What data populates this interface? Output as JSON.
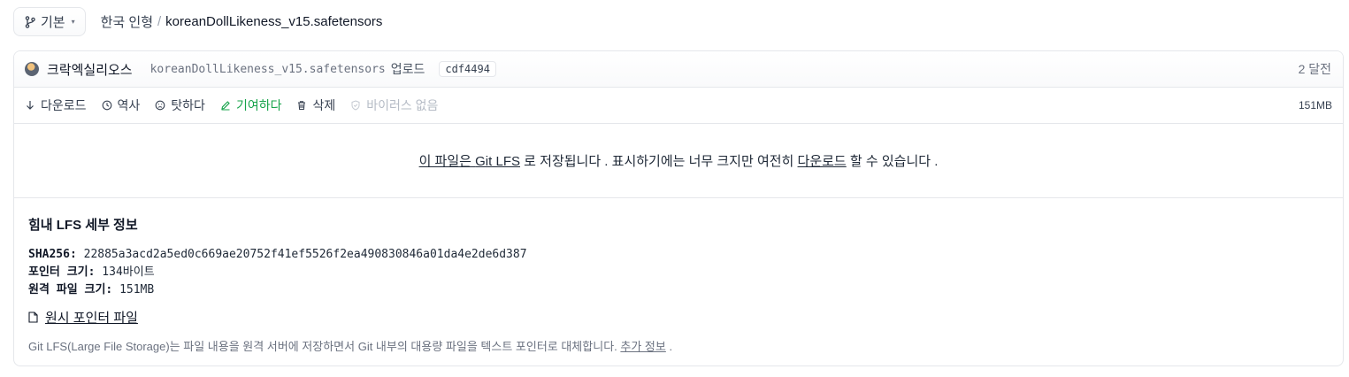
{
  "branch": {
    "label": "기본",
    "icon": "branch-icon",
    "caret": "▾"
  },
  "breadcrumb": {
    "repo": "한국 인형",
    "separator": "/",
    "file": "koreanDollLikeness_v15.safetensors"
  },
  "commit": {
    "author": "크락엑실리오스",
    "message_filename": "koreanDollLikeness_v15.safetensors",
    "message_suffix": "업로드",
    "sha": "cdf4494",
    "age": "2 달전"
  },
  "actions": {
    "download": "다운로드",
    "history": "역사",
    "blame": "탓하다",
    "contribute": "기여하다",
    "delete": "삭제",
    "no_virus": "바이러스 없음",
    "size": "151MB"
  },
  "lfs_message": {
    "part1": "이 파일은",
    "git_lfs": "Git LFS",
    "part2": "로 저장됩니다 . 표시하기에는 너무 크지만 여전히",
    "download_link": "다운로드",
    "part3": "할 수 있습니다 ."
  },
  "details": {
    "title": "힘내 LFS 세부 정보",
    "sha256_label": "SHA256:",
    "sha256_value": "22885a3acd2a5ed0c669ae20752f41ef5526f2ea490830846a01da4e2de6d387",
    "pointer_label": "포인터 크기:",
    "pointer_value": "134바이트",
    "remote_label": "원격 파일 크기:",
    "remote_value": "151MB",
    "raw_link": "원시 포인터 파일",
    "note": "Git LFS(Large File Storage)는 파일 내용을 원격 서버에 저장하면서 Git 내부의 대용량 파일을 텍스트 포인터로 대체합니다.",
    "more_link": "추가 정보",
    "note_end": "."
  },
  "colors": {
    "accent_green": "#16a34a",
    "border": "#e5e7eb",
    "muted": "#6b7280"
  }
}
